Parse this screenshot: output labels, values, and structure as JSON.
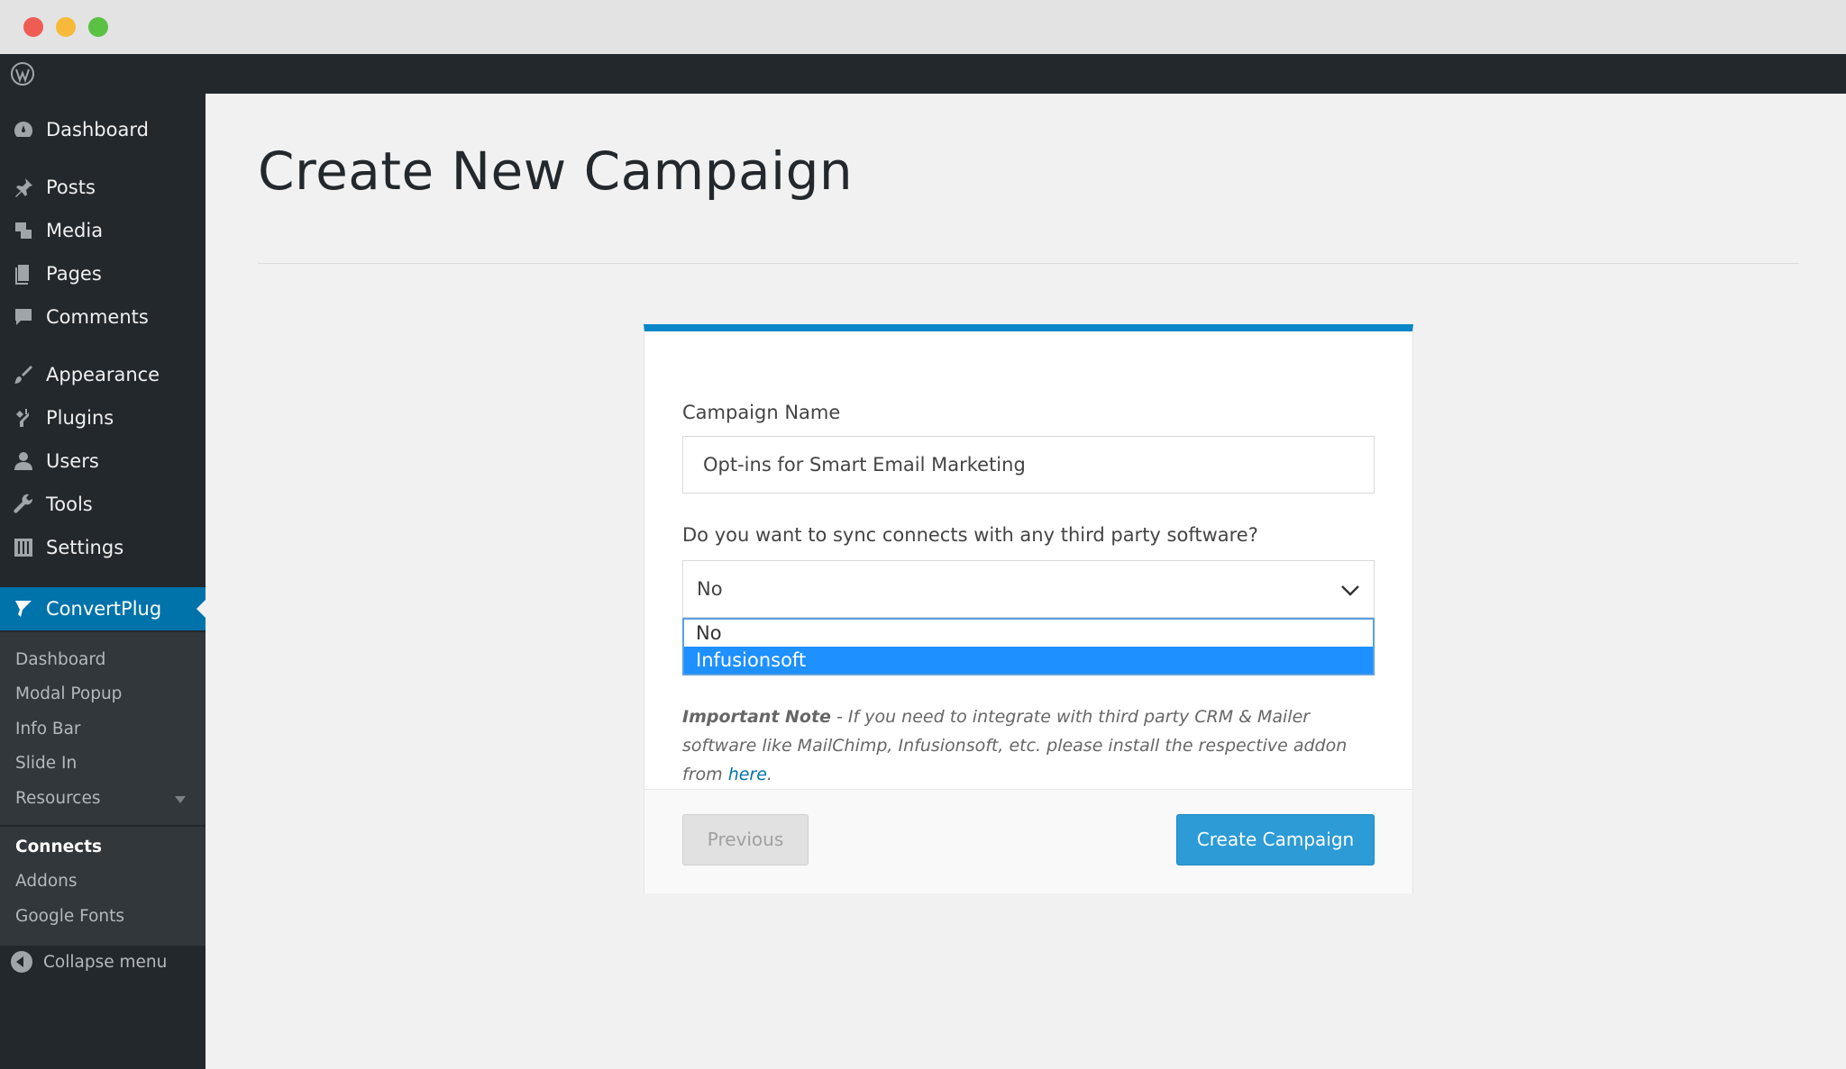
{
  "window": {
    "close": "red",
    "minimize": "yellow",
    "maximize": "green"
  },
  "sidebar": {
    "items": [
      {
        "label": "Dashboard",
        "icon": "dashboard-icon"
      },
      {
        "label": "Posts",
        "icon": "pin-icon"
      },
      {
        "label": "Media",
        "icon": "media-icon"
      },
      {
        "label": "Pages",
        "icon": "pages-icon"
      },
      {
        "label": "Comments",
        "icon": "comment-icon"
      },
      {
        "label": "Appearance",
        "icon": "brush-icon"
      },
      {
        "label": "Plugins",
        "icon": "plug-icon"
      },
      {
        "label": "Users",
        "icon": "user-icon"
      },
      {
        "label": "Tools",
        "icon": "wrench-icon"
      },
      {
        "label": "Settings",
        "icon": "settings-icon"
      },
      {
        "label": "ConvertPlug",
        "icon": "convertplug-icon"
      }
    ],
    "submenu": [
      "Dashboard",
      "Modal Popup",
      "Info Bar",
      "Slide In",
      "Resources",
      "Connects",
      "Addons",
      "Google Fonts"
    ],
    "collapse": "Collapse menu"
  },
  "main": {
    "title": "Create New Campaign",
    "form": {
      "campaign_label": "Campaign Name",
      "campaign_value": "Opt-ins for Smart Email Marketing",
      "sync_label": "Do you want to sync connects with any third party software?",
      "sync_value": "No",
      "options": [
        "No",
        "Infusionsoft"
      ],
      "note_bold": "Important Note",
      "note_text": " - If you need to integrate with third party CRM & Mailer software like MailChimp, Infusionsoft, etc. please install the respective addon from ",
      "note_link": "here",
      "note_end": ".",
      "prev_button": "Previous",
      "create_button": "Create Campaign"
    }
  },
  "colors": {
    "accent": "#0073aa",
    "card_top": "#0a86c9",
    "primary_button": "#2c9bd6",
    "selected_option": "#1e90ff"
  }
}
